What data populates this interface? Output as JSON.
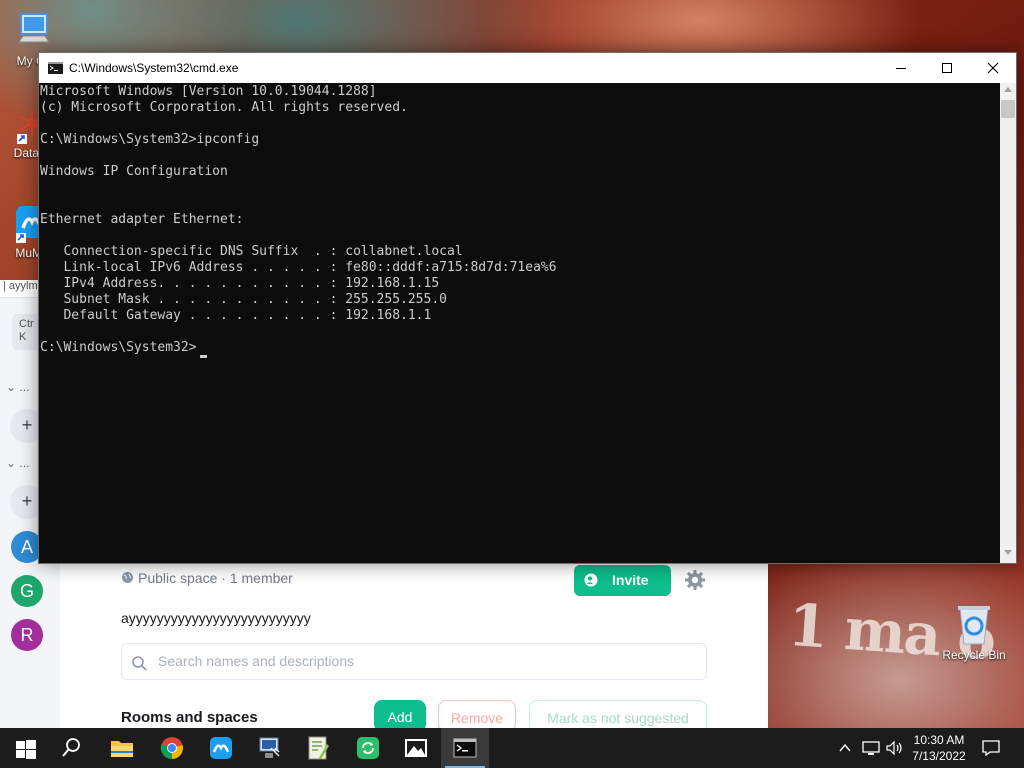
{
  "desktop": {
    "icons": [
      {
        "label": "My Co",
        "icon": "computer-icon"
      },
      {
        "label": "DataW",
        "icon": "datawrapper-icon"
      },
      {
        "label": "MuMu",
        "icon": "mumu-icon"
      },
      {
        "label": "Recycle Bin",
        "icon": "recycle-bin-icon"
      }
    ],
    "wallpaper_text": "1 ma o"
  },
  "background_app": {
    "search_stub": "| ayylm",
    "ctrl_k": "Ctr\nK",
    "section_dots": [
      "...",
      "..."
    ],
    "plus": [
      "+",
      "+"
    ],
    "avatars": [
      {
        "letter": "A",
        "color": "#2d8cd6"
      },
      {
        "letter": "G",
        "color": "#1ea66b"
      },
      {
        "letter": "R",
        "color": "#a22e9c"
      }
    ],
    "space_meta": "Public space · 1 member",
    "invite_label": "Invite",
    "topic": "ayyyyyyyyyyyyyyyyyyyyyyyyyy",
    "search_placeholder": "Search names and descriptions",
    "rooms_title": "Rooms and spaces",
    "add_label": "Add",
    "remove_label": "Remove",
    "mark_label": "Mark as not suggested",
    "accent": "#0dbd8b"
  },
  "cmd": {
    "title": "C:\\Windows\\System32\\cmd.exe",
    "lines": [
      "Microsoft Windows [Version 10.0.19044.1288]",
      "(c) Microsoft Corporation. All rights reserved.",
      "",
      "C:\\Windows\\System32>ipconfig",
      "",
      "Windows IP Configuration",
      "",
      "",
      "Ethernet adapter Ethernet:",
      "",
      "   Connection-specific DNS Suffix  . : collabnet.local",
      "   Link-local IPv6 Address . . . . . : fe80::dddf:a715:8d7d:71ea%6",
      "   IPv4 Address. . . . . . . . . . . : 192.168.1.15",
      "   Subnet Mask . . . . . . . . . . . : 255.255.255.0",
      "   Default Gateway . . . . . . . . . : 192.168.1.1",
      "",
      "C:\\Windows\\System32>"
    ],
    "background": "#0c0c0c",
    "foreground": "#cccccc"
  },
  "taskbar": {
    "items": [
      "start-icon",
      "search-icon",
      "file-explorer-icon",
      "chrome-icon",
      "mumu-icon",
      "network-tool-icon",
      "notepad-icon",
      "sync-icon",
      "photos-icon",
      "cmd-icon"
    ],
    "clock_time": "10:30 AM",
    "clock_date": "7/13/2022"
  }
}
